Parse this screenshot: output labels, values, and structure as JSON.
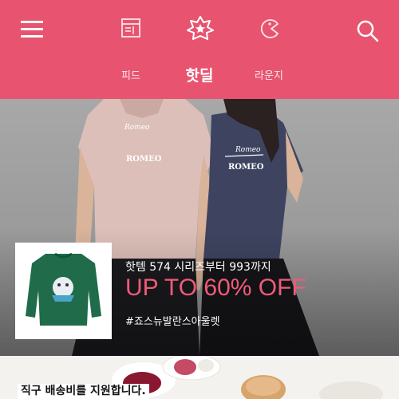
{
  "header": {
    "menu_icon": "hamburger-icon",
    "nav": [
      {
        "label": "피드",
        "icon": "feed-icon"
      },
      {
        "label": "핫딜",
        "icon": "hotdeal-icon",
        "active": true
      },
      {
        "label": "라운지",
        "icon": "lounge-icon"
      }
    ],
    "search_icon": "search-icon",
    "bg_color": "#e85470"
  },
  "banner": {
    "title": "핫템 574 시리즈부터 993까지",
    "promo": "UP TO 60% OFF",
    "tag": "#죠스뉴발란스아울렛",
    "promo_color": "#ef5b78"
  },
  "card2": {
    "text": "직구 배송비를 지원합니다."
  }
}
